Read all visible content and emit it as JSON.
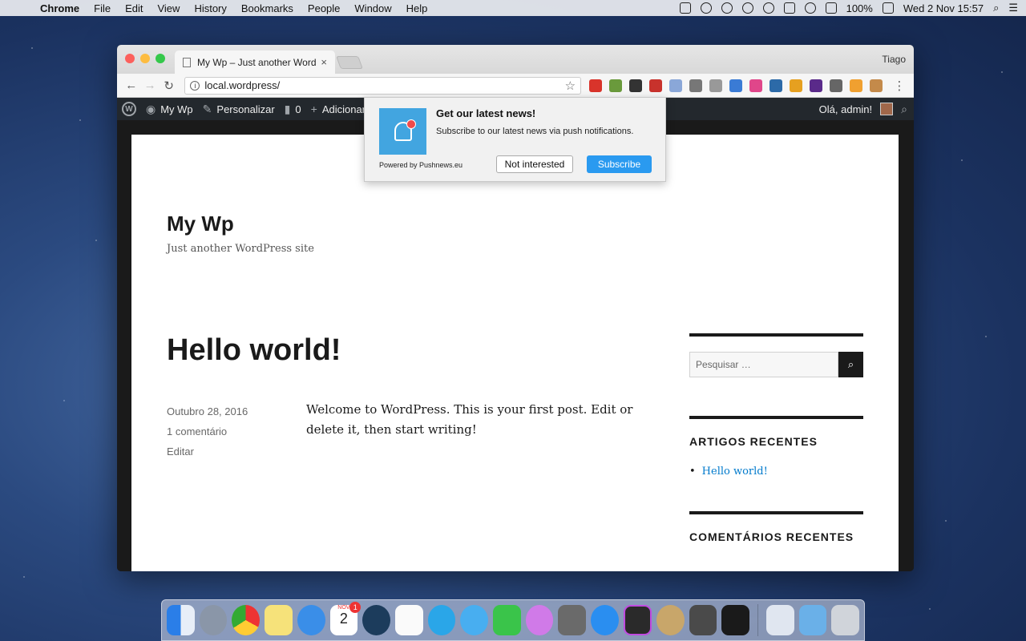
{
  "menubar": {
    "app": "Chrome",
    "items": [
      "File",
      "Edit",
      "View",
      "History",
      "Bookmarks",
      "People",
      "Window",
      "Help"
    ],
    "battery": "100%",
    "clock": "Wed 2 Nov  15:57"
  },
  "browser": {
    "tab_title": "My Wp – Just another WordPress site",
    "user": "Tiago",
    "url": "local.wordpress/"
  },
  "adminbar": {
    "site": "My Wp",
    "customize": "Personalizar",
    "comments_count": "0",
    "add": "Adicionar",
    "greeting": "Olá, admin!"
  },
  "site": {
    "title": "My Wp",
    "description": "Just another WordPress site"
  },
  "post": {
    "title": "Hello world!",
    "date": "Outubro 28, 2016",
    "comments": "1 comentário",
    "edit": "Editar",
    "content": "Welcome to WordPress. This is your first post. Edit or delete it, then start writing!"
  },
  "sidebar": {
    "search_placeholder": "Pesquisar …",
    "recent_posts_title": "ARTIGOS RECENTES",
    "recent_posts": [
      "Hello world!"
    ],
    "recent_comments_title": "COMENTÁRIOS RECENTES"
  },
  "popup": {
    "title": "Get our latest news!",
    "description": "Subscribe to our latest news via push notifications.",
    "powered": "Powered by Pushnews.eu",
    "decline": "Not interested",
    "accept": "Subscribe"
  },
  "dock": {
    "calendar_month": "NOV",
    "calendar_day": "2",
    "calendar_badge": "1",
    "apps": [
      "finder-icon",
      "launchpad-icon",
      "chrome-icon",
      "notes-icon",
      "safari-icon",
      "calendar-icon",
      "sourcetree-icon",
      "reminders-icon",
      "skype-icon",
      "messages-icon",
      "facetime-icon",
      "itunes-icon",
      "system-preferences-icon",
      "app-store-icon",
      "phpstorm-icon",
      "sequel-pro-icon",
      "sublime-text-icon",
      "terminal-icon",
      "downloads-folder-icon",
      "documents-folder-icon",
      "trash-icon"
    ]
  }
}
